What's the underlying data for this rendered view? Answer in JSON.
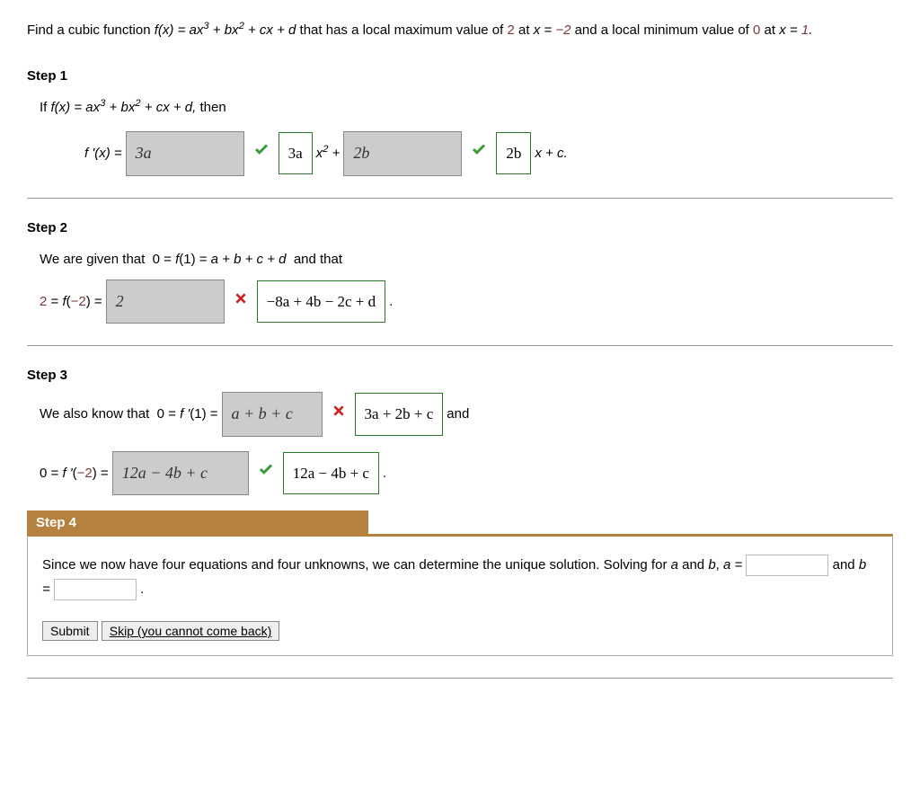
{
  "problem": {
    "text_pre": "Find a cubic function ",
    "fx": "f(x) = ax³ + bx² + cx + d",
    "text_mid": " that has a local maximum value of ",
    "val1": "2",
    "text_at1": " at ",
    "x1": "x = −2",
    "text_and": " and a local minimum value of ",
    "val2": "0",
    "text_at2": " at ",
    "x2": "x = 1."
  },
  "step1": {
    "label": "Step 1",
    "line1_pre": "If  ",
    "line1_fx": "f(x) = ax³ + bx² + cx + d,",
    "line1_post": "  then",
    "fprime": "f '(x) = ",
    "ans1": "3a",
    "corr1": "3a",
    "seg1": "x² + ",
    "ans2": "2b",
    "corr2": "2b",
    "seg2": "x + c."
  },
  "step2": {
    "label": "Step 2",
    "line1": "We are given that  0 = f(1) = a + b + c + d  and that",
    "eq_pre": "2 = f(−2) = ",
    "ans": "2",
    "corr": "−8a + 4b − 2c + d",
    "dot": "."
  },
  "step3": {
    "label": "Step 3",
    "line1_pre": "We also know that  0 = ",
    "fprime1": "f '(1) = ",
    "ans1": "a + b + c",
    "corr1": "3a + 2b + c",
    "and": "  and",
    "line2_pre": "0 = ",
    "fprime2": "f '(−2) = ",
    "ans2": "12a − 4b + c",
    "corr2": "12a − 4b + c",
    "dot": "."
  },
  "step4": {
    "label": "Step 4",
    "text_pre": "Since we now have four equations and four unknowns, we can determine the unique solution. Solving for ",
    "a_lbl": "a",
    "text_mid1": " and ",
    "b_lbl": "b",
    "text_mid2": ", ",
    "a_eq": "a = ",
    "text_mid3": " and ",
    "b_eq": "b = ",
    "dot": ".",
    "submit": "Submit",
    "skip": "Skip (you cannot come back)"
  }
}
